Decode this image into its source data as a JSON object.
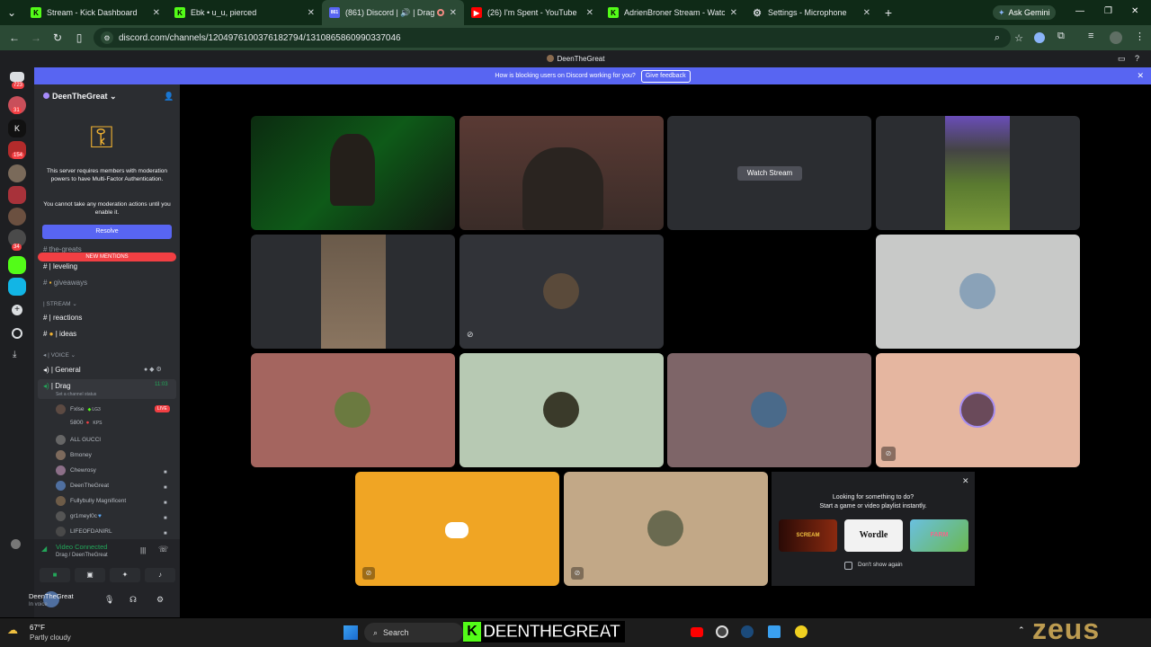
{
  "tabs": [
    {
      "title": "Stream - Kick Dashboard",
      "color": "#53fc18",
      "glyph": "K"
    },
    {
      "title": "Ebk • u_u, pierced",
      "color": "#53fc18",
      "glyph": "K"
    },
    {
      "title": "(861) Discord | 🔊 | Drag | D",
      "color": "#5865f2",
      "glyph": "861"
    },
    {
      "title": "(26) I'm Spent - YouTube",
      "color": "#ff0000",
      "glyph": "▶"
    },
    {
      "title": "AdrienBroner Stream - Watch L",
      "color": "#53fc18",
      "glyph": "K"
    },
    {
      "title": "Settings - Microphone",
      "color": "#9aa0a6",
      "glyph": "⚙"
    }
  ],
  "ask_gemini": "Ask Gemini",
  "url": "discord.com/channels/1204976100376182794/1310865860990337046",
  "discord_title": "DeenTheGreat",
  "banner": {
    "text": "How is blocking users on Discord working for you?",
    "button": "Give feedback"
  },
  "server_badges": [
    "723",
    "31",
    "154",
    "34"
  ],
  "sidebar": {
    "server_name": "DeenTheGreat",
    "mfa_text": "This server requires members with moderation powers to have Multi-Factor Authentication.",
    "mfa_text2": "You cannot take any moderation actions until you enable it.",
    "resolve": "Resolve",
    "new_mentions": "NEW MENTIONS",
    "channels": [
      {
        "name": "the-greats"
      },
      {
        "name": "| leveling"
      },
      {
        "name": "giveaways"
      },
      {
        "name": "| STREAM"
      },
      {
        "name": "| reactions"
      },
      {
        "name": "| ideas"
      },
      {
        "name": "| VOICE"
      },
      {
        "name": "| General"
      },
      {
        "name": "| Drag"
      }
    ],
    "drag_time": "11:03",
    "drag_status": "Set a channel status",
    "users": [
      "Fxlse",
      "5800",
      "ALL GUCCI",
      "Bmoney",
      "Chewrosy",
      "DeenTheGreat",
      "Fullybully Magnificent",
      "gr1meyl0c",
      "LIFEOFDANIRL"
    ],
    "user_tags": {
      "fxlse": "LG3",
      "s800": "KPS",
      "live": "LIVE"
    },
    "video_connected": "Video Connected",
    "voice_location": "Drag / DeenTheGreat",
    "username": "DeenTheGreat",
    "user_status": "In voice"
  },
  "main": {
    "watch_stream": "Watch Stream",
    "activity_title": "Looking for something to do?",
    "activity_sub": "Start a game or video playlist instantly.",
    "activities": [
      "SCREAM",
      "Wordle",
      "FARM"
    ],
    "dont_show": "Don't show again"
  },
  "taskbar": {
    "weather_temp": "67°F",
    "weather_desc": "Partly cloudy",
    "search": "Search",
    "kick_name": "DEENTHEGREAT",
    "zeus": "zeus"
  },
  "colors": {
    "blurple": "#5865f2",
    "green": "#23a559",
    "kick": "#53fc18",
    "red": "#f23f43"
  }
}
